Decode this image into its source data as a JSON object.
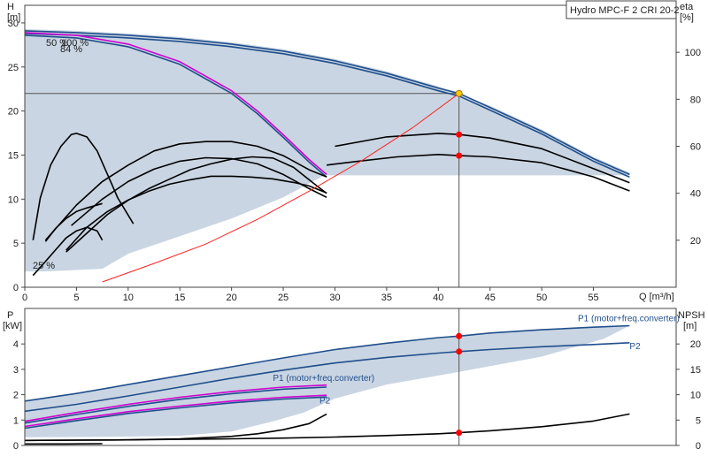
{
  "colors": {
    "envelope_fill": "#c9d5e2",
    "blue_curve": "#1f4e8c",
    "magenta_curve": "#d000d0",
    "black_curve": "#000000",
    "red_curve": "#ff2020",
    "op_point_red": "#ff0000",
    "op_point_yellow": "#ffcc00",
    "grid_line": "#555555"
  },
  "chart_data": [
    {
      "type": "line",
      "title": "Hydro MPC-F 2 CRI 20-2",
      "xlabel": "Q [m³/h]",
      "ylabel_left": "H",
      "ylabel_left_unit": "[m]",
      "ylabel_right": "eta",
      "ylabel_right_unit": "[%]",
      "xlim": [
        0,
        63
      ],
      "ylim_left": [
        0,
        32
      ],
      "ylim_right": [
        0,
        120
      ],
      "x_ticks": [
        0,
        5,
        10,
        15,
        20,
        25,
        30,
        35,
        40,
        45,
        50,
        55
      ],
      "y_left_ticks": [
        0,
        5,
        10,
        15,
        20,
        25,
        30
      ],
      "y_right_ticks": [
        20,
        40,
        60,
        80,
        100
      ],
      "annotations": [
        "50 %",
        "100 %",
        "84 %",
        "25 %"
      ],
      "operating_point": {
        "x": 42,
        "h": 22
      },
      "series": [
        {
          "kind": "envelope",
          "axis": "left",
          "x": [
            0,
            5,
            10,
            15,
            20,
            25,
            30,
            35,
            40,
            45,
            50,
            55,
            58.5,
            58.5,
            50,
            40,
            30,
            29,
            25,
            20,
            15,
            10,
            7.5,
            2,
            0
          ],
          "y": [
            29.3,
            29.1,
            28.8,
            28.4,
            27.8,
            27.0,
            25.9,
            24.5,
            22.8,
            20.6,
            17.9,
            14.8,
            13.0,
            12.7,
            12.7,
            12.7,
            12.7,
            12.7,
            10.2,
            7.8,
            5.8,
            3.8,
            2.1,
            1.8,
            1.8
          ]
        },
        {
          "kind": "head",
          "axis": "left",
          "color": "blue",
          "x": [
            0,
            5,
            10,
            15,
            20,
            25,
            30,
            35,
            40,
            42,
            45,
            50,
            55,
            58.5
          ],
          "y": [
            29.1,
            28.9,
            28.6,
            28.2,
            27.6,
            26.8,
            25.7,
            24.3,
            22.6,
            22.0,
            20.4,
            17.7,
            14.6,
            12.8
          ]
        },
        {
          "kind": "head",
          "axis": "left",
          "color": "blue",
          "x": [
            0,
            5,
            10,
            15,
            20,
            25,
            30,
            35,
            40,
            42,
            45,
            50,
            55,
            58.5
          ],
          "y": [
            28.8,
            28.6,
            28.3,
            27.9,
            27.3,
            26.5,
            25.4,
            24.0,
            22.3,
            21.7,
            20.1,
            17.4,
            14.3,
            12.5
          ]
        },
        {
          "kind": "head",
          "axis": "left",
          "color": "magenta",
          "x": [
            0,
            5,
            10,
            15,
            20,
            22.5,
            25,
            27.5,
            29.2
          ],
          "y": [
            28.9,
            28.6,
            27.6,
            25.6,
            22.3,
            20.0,
            17.3,
            14.5,
            12.8
          ]
        },
        {
          "kind": "head",
          "axis": "left",
          "color": "blue",
          "x": [
            0,
            5,
            10,
            15,
            20,
            22.5,
            25,
            27.5,
            29.2
          ],
          "y": [
            28.6,
            28.3,
            27.3,
            25.3,
            22.0,
            19.7,
            17.0,
            14.2,
            12.5
          ]
        },
        {
          "kind": "head",
          "axis": "left",
          "color": "black",
          "x": [
            4.5,
            7.5,
            10,
            12.5,
            15,
            17.5,
            20,
            22.5,
            25,
            27.5,
            29.2
          ],
          "y": [
            7.0,
            10.0,
            12.0,
            13.4,
            14.3,
            14.7,
            14.6,
            14.0,
            12.8,
            11.2,
            10.2
          ]
        },
        {
          "kind": "head",
          "axis": "left",
          "color": "black",
          "x": [
            4.0,
            6.0,
            8.0,
            10.0,
            12.0,
            14.0,
            16.0,
            18.0,
            20.0,
            22.0,
            24.0,
            26.0,
            27.5,
            29.2
          ],
          "y": [
            4.2,
            6.8,
            8.6,
            9.9,
            10.9,
            11.7,
            12.2,
            12.6,
            12.6,
            12.5,
            12.3,
            11.9,
            11.5,
            10.7
          ]
        },
        {
          "kind": "head",
          "axis": "left",
          "color": "black",
          "x": [
            2.0,
            3.0,
            4.0,
            5.0,
            6.0,
            7.5
          ],
          "y": [
            5.2,
            6.7,
            7.8,
            8.6,
            9.0,
            9.5
          ]
        },
        {
          "kind": "eta",
          "axis": "right",
          "color": "black",
          "x": [
            2.0,
            5.0,
            7.5,
            10,
            12.5,
            15,
            17.5,
            20,
            22.5,
            25,
            27.5,
            29.2
          ],
          "y": [
            20,
            35,
            45,
            52,
            58,
            61,
            62,
            62,
            60,
            56,
            50,
            47
          ]
        },
        {
          "kind": "eta",
          "axis": "right",
          "color": "black",
          "x": [
            4.0,
            6.0,
            8.0,
            10.0,
            12.0,
            14.0,
            16.0,
            18.0,
            20.0,
            22.0,
            24.0,
            26.0,
            28.0,
            29.2
          ],
          "y": [
            15,
            23,
            31,
            37,
            42,
            46,
            50,
            52.5,
            54.5,
            55.5,
            55,
            51,
            44,
            40
          ]
        },
        {
          "kind": "eta",
          "axis": "right",
          "color": "black",
          "x": [
            0.8,
            2.0,
            3.0,
            4.0,
            5.0,
            6.0,
            7.0,
            7.5
          ],
          "y": [
            5,
            11,
            16,
            21,
            24,
            25.5,
            24,
            20
          ]
        },
        {
          "kind": "eta",
          "axis": "right",
          "color": "black",
          "x": [
            0.8,
            1.5,
            2.5,
            3.5,
            4.5,
            5.0,
            6.0,
            7.0,
            8.0,
            9.0,
            10.5
          ],
          "y": [
            20,
            38,
            52,
            60,
            65,
            65.5,
            64,
            58,
            48,
            38,
            27
          ]
        },
        {
          "kind": "eta",
          "axis": "right",
          "color": "black",
          "x": [
            30,
            35,
            40,
            42,
            45,
            50,
            55,
            58.5
          ],
          "y": [
            60,
            64,
            65.5,
            65,
            63.5,
            59,
            50.5,
            44.5
          ]
        },
        {
          "kind": "eta",
          "axis": "right",
          "color": "black",
          "x": [
            29.2,
            32,
            36,
            40,
            42,
            45,
            50,
            55,
            58.5
          ],
          "y": [
            52,
            53.5,
            55.5,
            56.5,
            56,
            55.5,
            53,
            47,
            41
          ]
        },
        {
          "kind": "system",
          "axis": "left",
          "color": "red",
          "x": [
            7.5,
            12.5,
            17.5,
            22.5,
            27.5,
            32.5,
            37.5,
            42
          ],
          "y": [
            0.6,
            2.7,
            4.9,
            7.7,
            10.9,
            14.3,
            18.1,
            22.0
          ]
        }
      ],
      "markers": [
        {
          "x": 42,
          "axis": "left",
          "y": 22.0,
          "color": "yellow"
        },
        {
          "x": 42,
          "axis": "right",
          "y": 65,
          "color": "red"
        },
        {
          "x": 42,
          "axis": "right",
          "y": 56,
          "color": "red"
        }
      ]
    },
    {
      "type": "line",
      "xlabel": "",
      "ylabel_left": "P",
      "ylabel_left_unit": "[kW]",
      "ylabel_right": "NPSH",
      "ylabel_right_unit": "[m]",
      "xlim": [
        0,
        63
      ],
      "ylim_left": [
        0,
        5.4
      ],
      "ylim_right": [
        0,
        27
      ],
      "y_left_ticks": [
        0,
        1,
        2,
        3,
        4
      ],
      "y_right_ticks": [
        0,
        5,
        10,
        15,
        20
      ],
      "series_labels": [
        {
          "text": "P1 (motor+freq.converter)",
          "x": 53.5,
          "y": 4.9
        },
        {
          "text": "P2",
          "x": 58.5,
          "y": 3.8
        },
        {
          "text": "P1 (motor+freq.converter)",
          "x": 24,
          "y": 2.55
        },
        {
          "text": "P2",
          "x": 28.5,
          "y": 1.65
        }
      ],
      "series": [
        {
          "kind": "envelope",
          "axis": "left",
          "x": [
            0,
            5,
            10,
            15,
            20,
            25,
            30,
            35,
            40,
            45,
            50,
            55,
            58.5,
            56,
            50,
            42,
            35,
            30,
            27,
            24,
            20,
            15,
            10,
            5,
            0
          ],
          "y": [
            1.75,
            2.05,
            2.4,
            2.75,
            3.1,
            3.45,
            3.78,
            4.03,
            4.25,
            4.43,
            4.56,
            4.66,
            4.72,
            4.2,
            3.5,
            2.9,
            2.4,
            1.85,
            1.3,
            0.95,
            0.55,
            0.38,
            0.35,
            0.33,
            0.32
          ]
        },
        {
          "kind": "power",
          "axis": "left",
          "color": "blue",
          "name": "P1 (motor+freq.converter)",
          "x": [
            0,
            5,
            10,
            15,
            20,
            25,
            30,
            35,
            40,
            42,
            45,
            50,
            55,
            58.5
          ],
          "y": [
            1.75,
            2.05,
            2.4,
            2.75,
            3.1,
            3.45,
            3.78,
            4.03,
            4.25,
            4.31,
            4.43,
            4.56,
            4.66,
            4.72
          ]
        },
        {
          "kind": "power",
          "axis": "left",
          "color": "blue",
          "name": "P2",
          "x": [
            0,
            5,
            10,
            15,
            20,
            25,
            30,
            35,
            40,
            42,
            45,
            50,
            55,
            58.5
          ],
          "y": [
            1.35,
            1.62,
            1.95,
            2.3,
            2.65,
            2.97,
            3.25,
            3.47,
            3.64,
            3.7,
            3.78,
            3.89,
            3.98,
            4.05
          ]
        },
        {
          "kind": "power",
          "axis": "left",
          "color": "magenta",
          "x": [
            0,
            5,
            10,
            15,
            20,
            25,
            29.2
          ],
          "y": [
            0.95,
            1.3,
            1.62,
            1.9,
            2.12,
            2.3,
            2.38
          ]
        },
        {
          "kind": "power",
          "axis": "left",
          "color": "blue",
          "x": [
            0,
            5,
            10,
            15,
            20,
            25,
            29.2
          ],
          "y": [
            0.88,
            1.22,
            1.54,
            1.82,
            2.04,
            2.22,
            2.3
          ]
        },
        {
          "kind": "power",
          "axis": "left",
          "color": "magenta",
          "x": [
            0,
            5,
            10,
            15,
            20,
            25,
            29.2
          ],
          "y": [
            0.75,
            1.05,
            1.33,
            1.55,
            1.75,
            1.9,
            1.98
          ]
        },
        {
          "kind": "power",
          "axis": "left",
          "color": "blue",
          "x": [
            0,
            5,
            10,
            15,
            20,
            25,
            29.2
          ],
          "y": [
            0.68,
            0.98,
            1.26,
            1.48,
            1.68,
            1.83,
            1.91
          ]
        },
        {
          "kind": "npsh",
          "axis": "right",
          "color": "black",
          "x": [
            0,
            5,
            10,
            15,
            20,
            22.5,
            25,
            27.5,
            29.2
          ],
          "y": [
            1.0,
            1.05,
            1.1,
            1.3,
            1.8,
            2.3,
            3.1,
            4.3,
            6.2
          ]
        },
        {
          "kind": "npsh",
          "axis": "right",
          "color": "black",
          "x": [
            0,
            5,
            10,
            15,
            20,
            25,
            30,
            35,
            40,
            42,
            45,
            50,
            55,
            58.5
          ],
          "y": [
            1.0,
            1.05,
            1.1,
            1.2,
            1.3,
            1.45,
            1.65,
            1.95,
            2.3,
            2.5,
            2.9,
            3.7,
            4.8,
            6.2
          ]
        },
        {
          "kind": "npsh",
          "axis": "right",
          "color": "black",
          "x": [
            0,
            4,
            7.5
          ],
          "y": [
            0.3,
            0.3,
            0.35
          ]
        }
      ],
      "markers": [
        {
          "x": 42,
          "axis": "left",
          "y": 4.31,
          "color": "red"
        },
        {
          "x": 42,
          "axis": "left",
          "y": 3.7,
          "color": "red"
        },
        {
          "x": 42,
          "axis": "right",
          "y": 2.5,
          "color": "red"
        }
      ]
    }
  ]
}
